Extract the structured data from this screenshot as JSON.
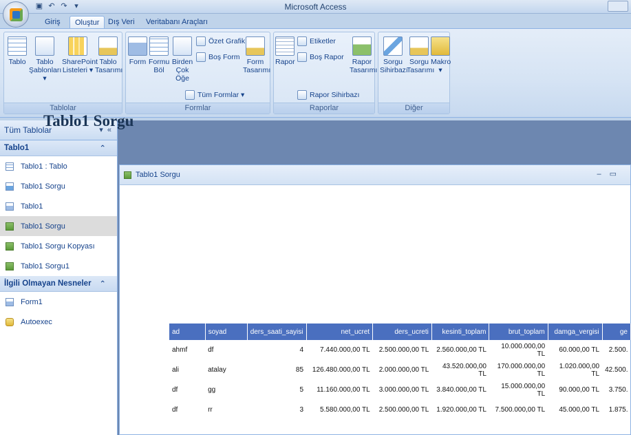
{
  "window": {
    "title": "Microsoft Access"
  },
  "ribbon": {
    "tabs": [
      "Giriş",
      "Oluştur",
      "Dış Veri",
      "Veritabanı Araçları"
    ],
    "active_tab": "Oluştur",
    "groups": {
      "tablolar": {
        "label": "Tablolar",
        "buttons": [
          {
            "label": "Tablo"
          },
          {
            "label": "Tablo Şablonları ▾"
          },
          {
            "label": "SharePoint Listeleri ▾"
          },
          {
            "label": "Tablo Tasarımı"
          }
        ]
      },
      "formlar": {
        "label": "Formlar",
        "buttons": [
          {
            "label": "Form"
          },
          {
            "label": "Formu Böl"
          },
          {
            "label": "Birden Çok Öğe"
          },
          {
            "label": "Form Tasarımı"
          }
        ],
        "small_buttons": [
          "Özet Grafik",
          "Boş Form",
          "Tüm Formlar ▾"
        ]
      },
      "raporlar": {
        "label": "Raporlar",
        "buttons": [
          {
            "label": "Rapor"
          },
          {
            "label": "Rapor Tasarımı"
          }
        ],
        "small_buttons": [
          "Etiketler",
          "Boş Rapor",
          "Rapor Sihirbazı"
        ]
      },
      "diger": {
        "label": "Diğer",
        "buttons": [
          {
            "label": "Sorgu Sihirbazı"
          },
          {
            "label": "Sorgu Tasarımı"
          },
          {
            "label": "Makro ▾"
          }
        ]
      }
    }
  },
  "nav": {
    "header": "Tüm Tablolar",
    "groups": [
      {
        "label": "Tablo1",
        "items": [
          {
            "label": "Tablo1 : Tablo",
            "icon": "table-icon"
          },
          {
            "label": "Tablo1 Sorgu",
            "icon": "query-icon"
          },
          {
            "label": "Tablo1",
            "icon": "form-icon"
          },
          {
            "label": "Tablo1 Sorgu",
            "icon": "report-icon",
            "selected": true
          },
          {
            "label": "Tablo1 Sorgu Kopyası",
            "icon": "report-icon"
          },
          {
            "label": "Tablo1 Sorgu1",
            "icon": "report-icon"
          }
        ]
      },
      {
        "label": "İlgili Olmayan Nesneler",
        "items": [
          {
            "label": "Form1",
            "icon": "form-icon"
          },
          {
            "label": "Autoexec",
            "icon": "macro-icon"
          }
        ]
      }
    ]
  },
  "document": {
    "tab_title": "Tablo1 Sorgu",
    "report_title": "Tablo1 Sorgu",
    "columns": [
      "ad",
      "soyad",
      "ders_saati_sayisi",
      "net_ucret",
      "ders_ucreti",
      "kesinti_toplam",
      "brut_toplam",
      "damga_vergisi",
      "ge"
    ],
    "rows": [
      [
        "ahmf",
        "df",
        "4",
        "7.440.000,00 TL",
        "2.500.000,00 TL",
        "2.560.000,00 TL",
        "10.000.000,00 TL",
        "60.000,00 TL",
        "2.500."
      ],
      [
        "ali",
        "atalay",
        "85",
        "126.480.000,00 TL",
        "2.000.000,00 TL",
        "43.520.000,00 TL",
        "170.000.000,00 TL",
        "1.020.000,00 TL",
        "42.500."
      ],
      [
        "df",
        "gg",
        "5",
        "11.160.000,00 TL",
        "3.000.000,00 TL",
        "3.840.000,00 TL",
        "15.000.000,00 TL",
        "90.000,00 TL",
        "3.750."
      ],
      [
        "df",
        "rr",
        "3",
        "5.580.000,00 TL",
        "2.500.000,00 TL",
        "1.920.000,00 TL",
        "7.500.000,00 TL",
        "45.000,00 TL",
        "1.875."
      ]
    ]
  }
}
